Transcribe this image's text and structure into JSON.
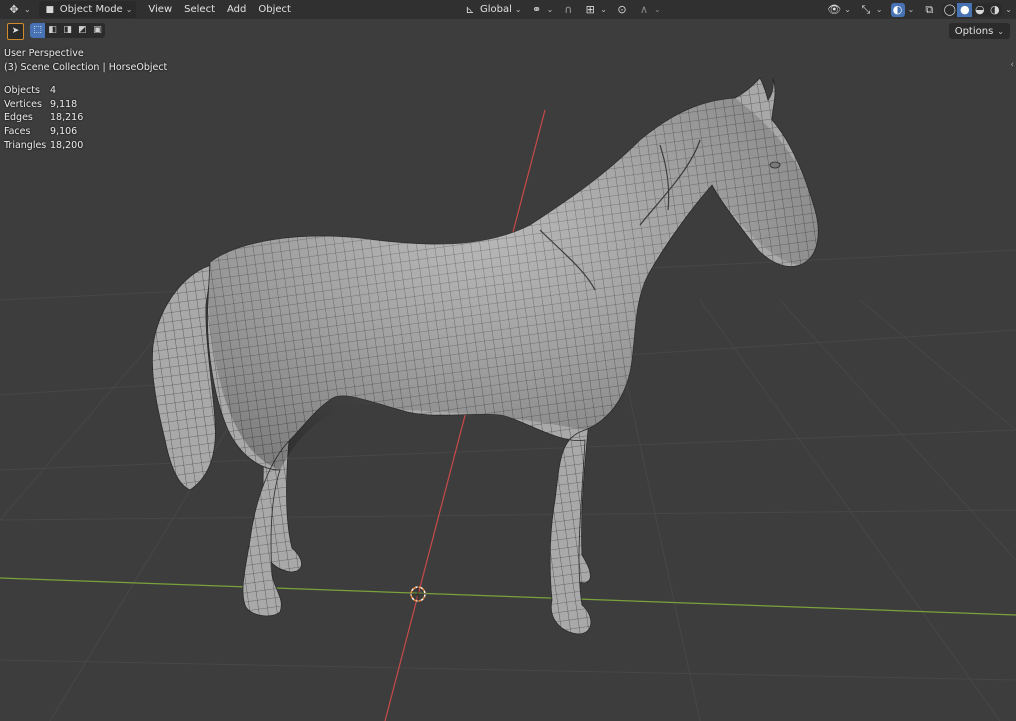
{
  "header": {
    "editor_type_icon": "3d-viewport-icon",
    "mode": "Object Mode",
    "menus": [
      "View",
      "Select",
      "Add",
      "Object"
    ],
    "transform_orientation": "Global",
    "right_icons": [
      "visibility-icon",
      "gizmo-icon",
      "overlay-icon",
      "xray-icon",
      "wireframe-shading-icon",
      "solid-shading-icon",
      "material-shading-icon",
      "rendered-shading-icon"
    ]
  },
  "toolbar": {
    "options_label": "Options"
  },
  "viewport": {
    "view_name": "User Perspective",
    "collection_info": "(3) Scene Collection | HorseObject",
    "stats": [
      {
        "label": "Objects",
        "value": "4"
      },
      {
        "label": "Vertices",
        "value": "9,118"
      },
      {
        "label": "Edges",
        "value": "18,216"
      },
      {
        "label": "Faces",
        "value": "9,106"
      },
      {
        "label": "Triangles",
        "value": "18,200"
      }
    ],
    "colors": {
      "background": "#3d3d3d",
      "grid": "#474747",
      "x_axis": "#c94a4a",
      "y_axis": "#7aa23a",
      "mesh_fill": "#a8a8a8",
      "mesh_wire": "#2c2c2c",
      "cursor": "#e8873a"
    }
  }
}
